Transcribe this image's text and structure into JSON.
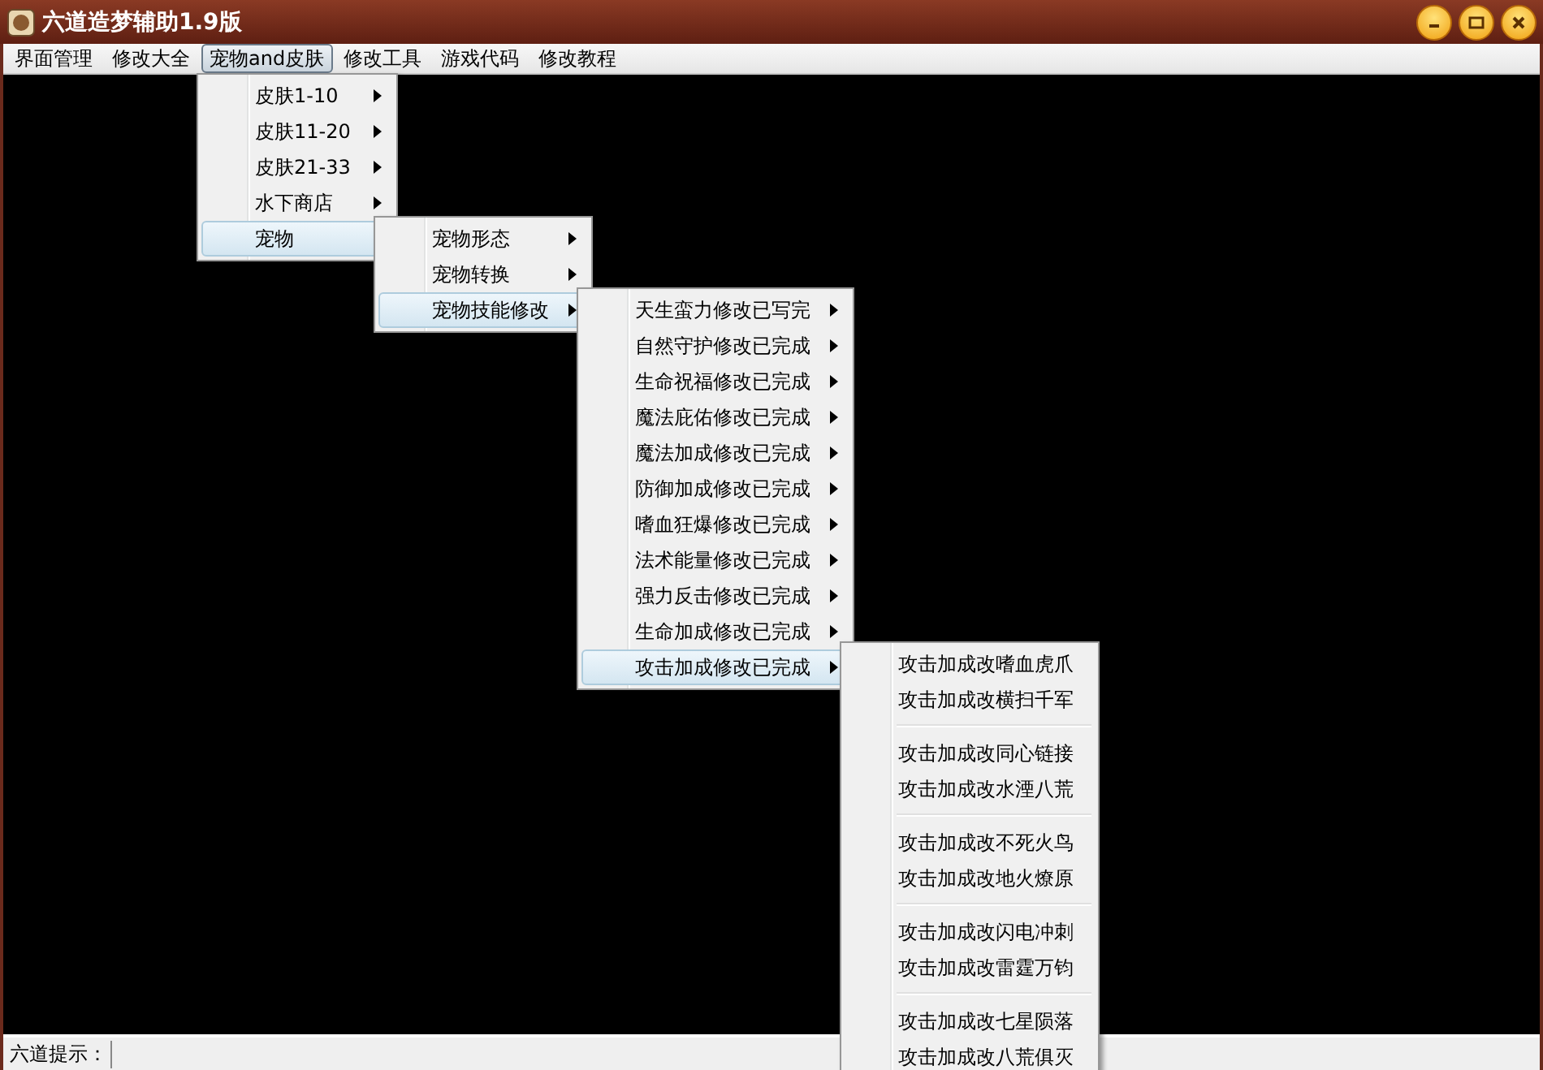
{
  "window": {
    "title": "六道造梦辅助1.9版"
  },
  "menubar": [
    {
      "label": "界面管理",
      "selected": false
    },
    {
      "label": "修改大全",
      "selected": false
    },
    {
      "label": "宠物and皮肤",
      "selected": true
    },
    {
      "label": "修改工具",
      "selected": false
    },
    {
      "label": "游戏代码",
      "selected": false
    },
    {
      "label": "修改教程",
      "selected": false
    }
  ],
  "menus": [
    {
      "items": [
        {
          "kind": "item",
          "label": "皮肤1-10",
          "submenu": true,
          "selected": false
        },
        {
          "kind": "item",
          "label": "皮肤11-20",
          "submenu": true,
          "selected": false
        },
        {
          "kind": "item",
          "label": "皮肤21-33",
          "submenu": true,
          "selected": false
        },
        {
          "kind": "item",
          "label": "水下商店",
          "submenu": true,
          "selected": false
        },
        {
          "kind": "item",
          "label": "宠物",
          "submenu": true,
          "selected": true
        }
      ]
    },
    {
      "items": [
        {
          "kind": "item",
          "label": "宠物形态",
          "submenu": true,
          "selected": false
        },
        {
          "kind": "item",
          "label": "宠物转换",
          "submenu": true,
          "selected": false
        },
        {
          "kind": "item",
          "label": "宠物技能修改",
          "submenu": true,
          "selected": true
        }
      ]
    },
    {
      "items": [
        {
          "kind": "item",
          "label": "天生蛮力修改已写完",
          "submenu": true,
          "selected": false
        },
        {
          "kind": "item",
          "label": "自然守护修改已完成",
          "submenu": true,
          "selected": false
        },
        {
          "kind": "item",
          "label": "生命祝福修改已完成",
          "submenu": true,
          "selected": false
        },
        {
          "kind": "item",
          "label": "魔法庇佑修改已完成",
          "submenu": true,
          "selected": false
        },
        {
          "kind": "item",
          "label": "魔法加成修改已完成",
          "submenu": true,
          "selected": false
        },
        {
          "kind": "item",
          "label": "防御加成修改已完成",
          "submenu": true,
          "selected": false
        },
        {
          "kind": "item",
          "label": "嗜血狂爆修改已完成",
          "submenu": true,
          "selected": false
        },
        {
          "kind": "item",
          "label": "法术能量修改已完成",
          "submenu": true,
          "selected": false
        },
        {
          "kind": "item",
          "label": "强力反击修改已完成",
          "submenu": true,
          "selected": false
        },
        {
          "kind": "item",
          "label": "生命加成修改已完成",
          "submenu": true,
          "selected": false
        },
        {
          "kind": "item",
          "label": "攻击加成修改已完成",
          "submenu": true,
          "selected": true
        }
      ]
    },
    {
      "items": [
        {
          "kind": "item",
          "label": "攻击加成改嗜血虎爪",
          "submenu": false,
          "selected": false
        },
        {
          "kind": "item",
          "label": "攻击加成改横扫千军",
          "submenu": false,
          "selected": false
        },
        {
          "kind": "separator"
        },
        {
          "kind": "item",
          "label": "攻击加成改同心链接",
          "submenu": false,
          "selected": false
        },
        {
          "kind": "item",
          "label": "攻击加成改水湮八荒",
          "submenu": false,
          "selected": false
        },
        {
          "kind": "separator"
        },
        {
          "kind": "item",
          "label": "攻击加成改不死火鸟",
          "submenu": false,
          "selected": false
        },
        {
          "kind": "item",
          "label": "攻击加成改地火燎原",
          "submenu": false,
          "selected": false
        },
        {
          "kind": "separator"
        },
        {
          "kind": "item",
          "label": "攻击加成改闪电冲刺",
          "submenu": false,
          "selected": false
        },
        {
          "kind": "item",
          "label": "攻击加成改雷霆万钧",
          "submenu": false,
          "selected": false
        },
        {
          "kind": "separator"
        },
        {
          "kind": "item",
          "label": "攻击加成改七星陨落",
          "submenu": false,
          "selected": false
        },
        {
          "kind": "item",
          "label": "攻击加成改八荒俱灭",
          "submenu": false,
          "selected": false
        }
      ]
    }
  ],
  "status_bar": {
    "label": "六道提示："
  }
}
